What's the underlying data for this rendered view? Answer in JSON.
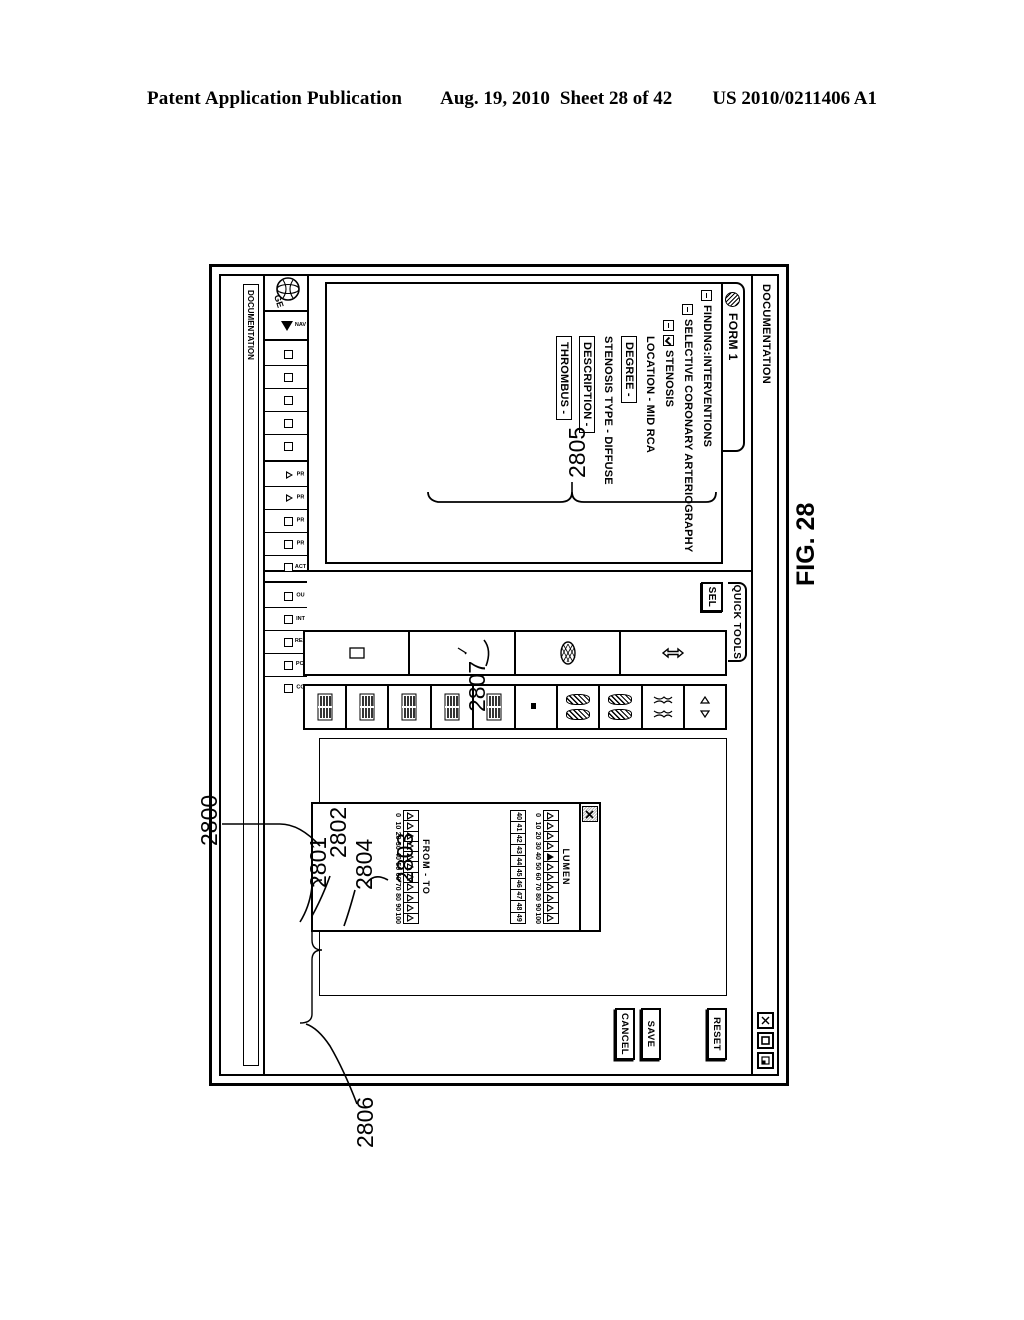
{
  "patent_header": {
    "publication": "Patent Application Publication",
    "date": "Aug. 19, 2010",
    "sheet": "Sheet 28 of 42",
    "number": "US 2010/0211406 A1"
  },
  "figure": {
    "label": "FIG. 28",
    "reference_numerals": [
      "2800",
      "2801",
      "2802",
      "2803",
      "2804",
      "2805",
      "2806",
      "2807"
    ]
  },
  "window": {
    "title": "DOCUMENTATION",
    "controls": [
      {
        "name": "close-icon",
        "glyph": "X"
      },
      {
        "name": "maximize-icon",
        "glyph": "square"
      },
      {
        "name": "minimize-icon",
        "glyph": "restore"
      }
    ]
  },
  "form_panel": {
    "header_label": "FORM 1",
    "tree": [
      {
        "level": 1,
        "toggle": "minus",
        "label": "FINDING:INTERVENTIONS",
        "kind": "node"
      },
      {
        "level": 2,
        "toggle": "minus",
        "label": "SELECTIVE CORONARY ARTERIOGRAPHY",
        "kind": "node"
      },
      {
        "level": 3,
        "toggle": "minus",
        "checkbox": true,
        "label": "STENOSIS",
        "kind": "checked-node"
      },
      {
        "level": 4,
        "label": "LOCATION - MID RCA",
        "kind": "value"
      },
      {
        "level": 4,
        "label": "DEGREE -",
        "kind": "field"
      },
      {
        "level": 4,
        "label": "STENOSIS TYPE - DIFFUSE",
        "kind": "value"
      },
      {
        "level": 4,
        "label": "DESCRIPTION -",
        "kind": "field"
      },
      {
        "level": 4,
        "label": "THROMBUS -",
        "kind": "field"
      }
    ]
  },
  "quick_tools": {
    "tab_label": "QUICK TOOLS",
    "select_button": "SEL",
    "palette_a": [
      {
        "name": "stenosis-pattern-icon-1"
      },
      {
        "name": "stenosis-pattern-icon-2"
      },
      {
        "name": "stenosis-pattern-icon-3"
      },
      {
        "name": "stenosis-pattern-icon-4"
      },
      {
        "name": "stenosis-pattern-icon-5"
      },
      {
        "name": "blank-tool-icon"
      },
      {
        "name": "vessel-pair-icon-1"
      },
      {
        "name": "vessel-pair-icon-2"
      },
      {
        "name": "irregular-vessel-icon"
      },
      {
        "name": "arrow-pair-icon"
      }
    ],
    "palette_b": [
      {
        "name": "resize-arrows-icon"
      },
      {
        "name": "hatched-oval-icon"
      },
      {
        "name": "marker-icon"
      },
      {
        "name": "page-icon"
      }
    ]
  },
  "measurement_panel": {
    "close_icon": "close-icon",
    "scales": [
      {
        "name": "LUMEN",
        "selected_value": 40,
        "tick_labels": [
          "0",
          "10",
          "20",
          "30",
          "40",
          "50",
          "60",
          "70",
          "80",
          "90",
          "100"
        ],
        "marker_labels": [
          "40",
          "41",
          "42",
          "43",
          "44",
          "45",
          "46",
          "47",
          "48",
          "49"
        ]
      },
      {
        "name": "FROM - TO",
        "tick_labels": [
          "0",
          "10",
          "20",
          "30",
          "40",
          "50",
          "60",
          "70",
          "80",
          "90",
          "100"
        ]
      }
    ]
  },
  "actions": {
    "cancel": "CANCEL",
    "save": "SAVE",
    "reset": "RESET"
  },
  "status_bar": {
    "text": "DOCUMENTATION"
  },
  "bottom_toolbar": {
    "groups": [
      {
        "name": "navigation-group",
        "items": [
          {
            "label": "NAV",
            "shape": "play"
          }
        ]
      },
      {
        "name": "primary-group",
        "items": [
          {
            "label": "",
            "shape": "square"
          },
          {
            "label": "",
            "shape": "square"
          },
          {
            "label": "",
            "shape": "square"
          },
          {
            "label": "",
            "shape": "square"
          },
          {
            "label": "",
            "shape": "square"
          }
        ]
      },
      {
        "name": "finding-group",
        "items": [
          {
            "label": "PR",
            "shape": "triangle"
          },
          {
            "label": "PR",
            "shape": "triangle"
          },
          {
            "label": "PR",
            "shape": "square"
          },
          {
            "label": "PR",
            "shape": "square"
          },
          {
            "label": "ACT",
            "shape": "square"
          }
        ]
      },
      {
        "name": "result-group",
        "items": [
          {
            "label": "OU",
            "shape": "square"
          },
          {
            "label": "INT",
            "shape": "square"
          },
          {
            "label": "RES",
            "shape": "square"
          },
          {
            "label": "PCI",
            "shape": "square"
          },
          {
            "label": "CO",
            "shape": "square"
          }
        ]
      }
    ]
  }
}
